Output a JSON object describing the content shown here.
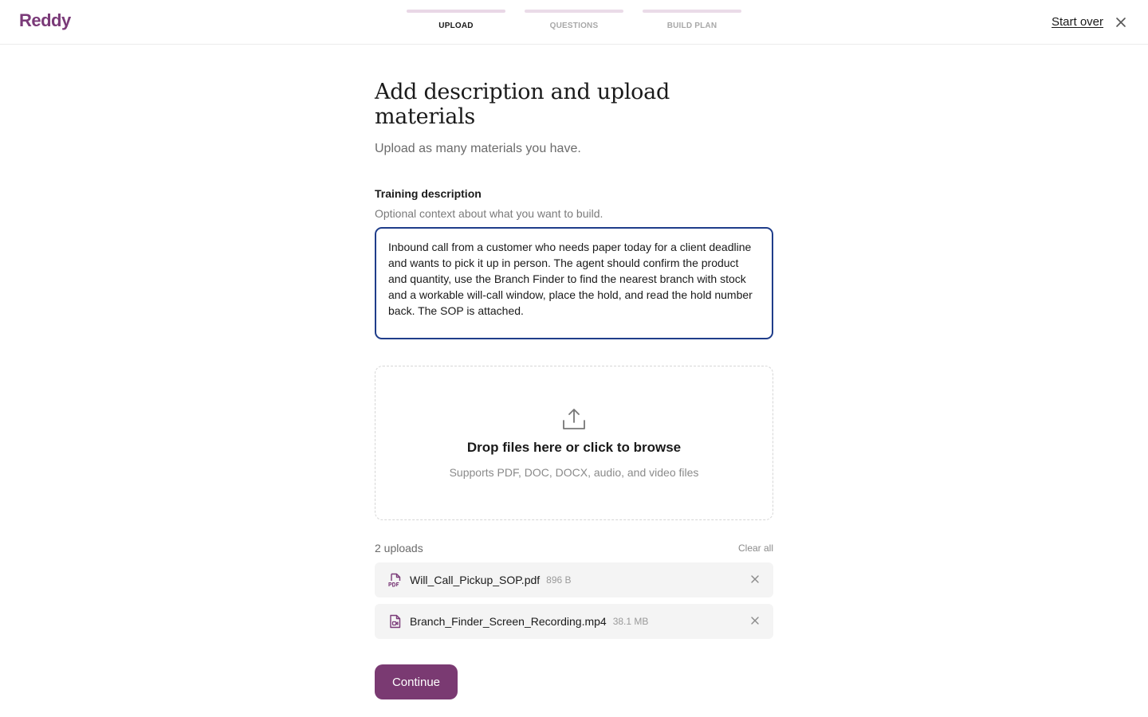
{
  "header": {
    "logo": "Reddy",
    "steps": [
      {
        "label": "UPLOAD",
        "active": true
      },
      {
        "label": "QUESTIONS",
        "active": false
      },
      {
        "label": "BUILD PLAN",
        "active": false
      }
    ],
    "start_over": "Start over",
    "close_icon": "close-icon"
  },
  "main": {
    "title": "Add description and upload materials",
    "subtitle": "Upload as many materials you have.",
    "description": {
      "label": "Training description",
      "help": "Optional context about what you want to build.",
      "value": "Inbound call from a customer who needs paper today for a client deadline and wants to pick it up in person. The agent should confirm the product and quantity, use the Branch Finder to find the nearest branch with stock and a workable will-call window, place the hold, and read the hold number back. The SOP is attached."
    },
    "dropzone": {
      "icon": "upload-icon",
      "title": "Drop files here or click to browse",
      "subtitle": "Supports PDF, DOC, DOCX, audio, and video files"
    },
    "uploads": {
      "count_label": "2 uploads",
      "clear_all": "Clear all",
      "files": [
        {
          "name": "Will_Call_Pickup_SOP.pdf",
          "size": "896 B",
          "icon": "pdf-file-icon"
        },
        {
          "name": "Branch_Finder_Screen_Recording.mp4",
          "size": "38.1 MB",
          "icon": "video-file-icon"
        }
      ]
    },
    "continue_label": "Continue"
  },
  "colors": {
    "brand": "#7a3a78",
    "button": "#7a3a72",
    "focus_border": "#1f3d8a"
  }
}
